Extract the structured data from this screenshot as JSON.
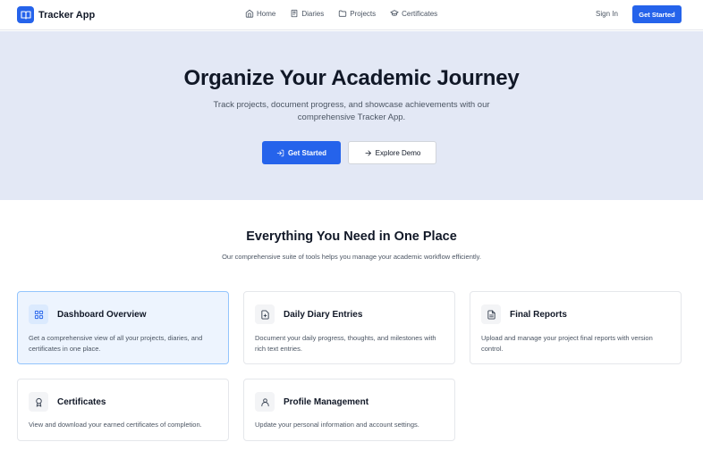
{
  "header": {
    "brand_name": "Tracker App",
    "nav": [
      {
        "label": "Home",
        "icon": "home-icon"
      },
      {
        "label": "Diaries",
        "icon": "book-icon"
      },
      {
        "label": "Projects",
        "icon": "folder-icon"
      },
      {
        "label": "Certificates",
        "icon": "graduation-cap-icon"
      }
    ],
    "sign_in": "Sign In",
    "cta": "Get Started"
  },
  "hero": {
    "title": "Organize Your Academic Journey",
    "subtitle": "Track projects, document progress, and showcase achievements with our comprehensive Tracker App.",
    "primary_button": "Get Started",
    "secondary_button": "Explore Demo"
  },
  "features": {
    "title": "Everything You Need in One Place",
    "subtitle": "Our comprehensive suite of tools helps you manage your academic workflow efficiently.",
    "cards": [
      {
        "title": "Dashboard Overview",
        "description": "Get a comprehensive view of all your projects, diaries, and certificates in one place.",
        "icon": "dashboard-icon"
      },
      {
        "title": "Daily Diary Entries",
        "description": "Document your daily progress, thoughts, and milestones with rich text entries.",
        "icon": "diary-icon"
      },
      {
        "title": "Final Reports",
        "description": "Upload and manage your project final reports with version control.",
        "icon": "report-icon"
      },
      {
        "title": "Certificates",
        "description": "View and download your earned certificates of completion.",
        "icon": "award-icon"
      },
      {
        "title": "Profile Management",
        "description": "Update your personal information and account settings.",
        "icon": "user-icon"
      }
    ]
  },
  "colors": {
    "accent": "#2563eb",
    "hero_bg": "#e3e8f5",
    "active_card_bg": "#edf4fe"
  }
}
